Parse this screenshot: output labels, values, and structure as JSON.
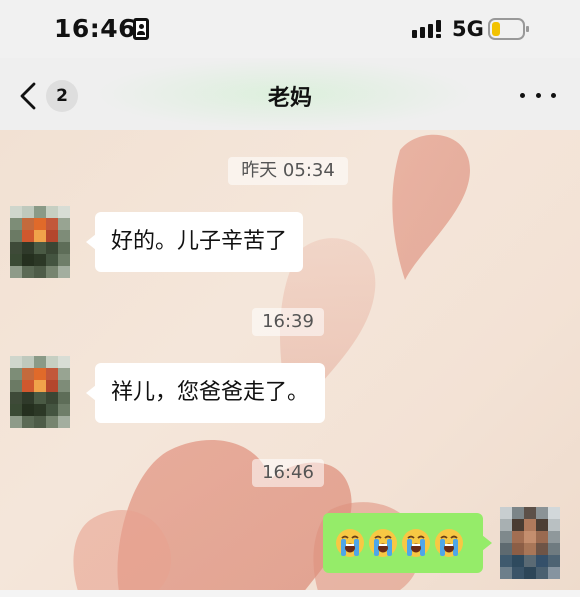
{
  "status_bar": {
    "time": "16:46",
    "network": "5G",
    "icons": [
      "id-card-icon",
      "signal-icon",
      "battery-icon"
    ]
  },
  "nav": {
    "back_icon": "chevron-left-icon",
    "unread_count": "2",
    "title": "老妈",
    "more_icon": "more-dots-icon"
  },
  "colors": {
    "outgoing_bubble": "#95ec69",
    "incoming_bubble": "#ffffff",
    "nav_bg": "#efefef",
    "wallpaper_heart": "#d9826e"
  },
  "messages": [
    {
      "type": "timestamp",
      "text": "昨天 05:34"
    },
    {
      "type": "incoming",
      "sender": "老妈",
      "text": "好的。儿子辛苦了"
    },
    {
      "type": "timestamp",
      "text": "16:39"
    },
    {
      "type": "incoming",
      "sender": "老妈",
      "text": "祥儿，您爸爸走了。"
    },
    {
      "type": "timestamp",
      "text": "16:46"
    },
    {
      "type": "outgoing",
      "emoji": [
        "loudly-crying-face-icon",
        "loudly-crying-face-icon",
        "loudly-crying-face-icon",
        "loudly-crying-face-icon"
      ]
    }
  ]
}
